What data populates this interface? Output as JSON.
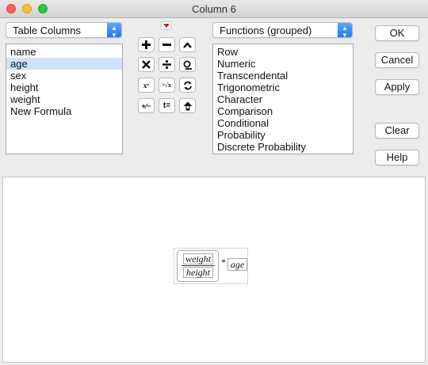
{
  "window": {
    "title": "Column 6"
  },
  "columns_popup": {
    "selected": "Table Columns"
  },
  "columns_list": [
    {
      "label": "name",
      "selected": false
    },
    {
      "label": "age",
      "selected": true
    },
    {
      "label": "sex",
      "selected": false
    },
    {
      "label": "height",
      "selected": false
    },
    {
      "label": "weight",
      "selected": false
    },
    {
      "label": "New Formula",
      "selected": false
    }
  ],
  "functions_popup": {
    "selected": "Functions (grouped)"
  },
  "functions_list": [
    "Row",
    "Numeric",
    "Transcendental",
    "Trigonometric",
    "Character",
    "Comparison",
    "Conditional",
    "Probability",
    "Discrete Probability"
  ],
  "toolbar": {
    "power_label": "xʸ",
    "root_label": "ʸ√x",
    "plusminus_label": "+∕−",
    "assign_label": "t="
  },
  "buttons": {
    "ok": "OK",
    "cancel": "Cancel",
    "apply": "Apply",
    "clear": "Clear",
    "help": "Help"
  },
  "formula": {
    "numerator": "weight",
    "denominator": "height",
    "operator": "*",
    "multiplier": "age"
  }
}
